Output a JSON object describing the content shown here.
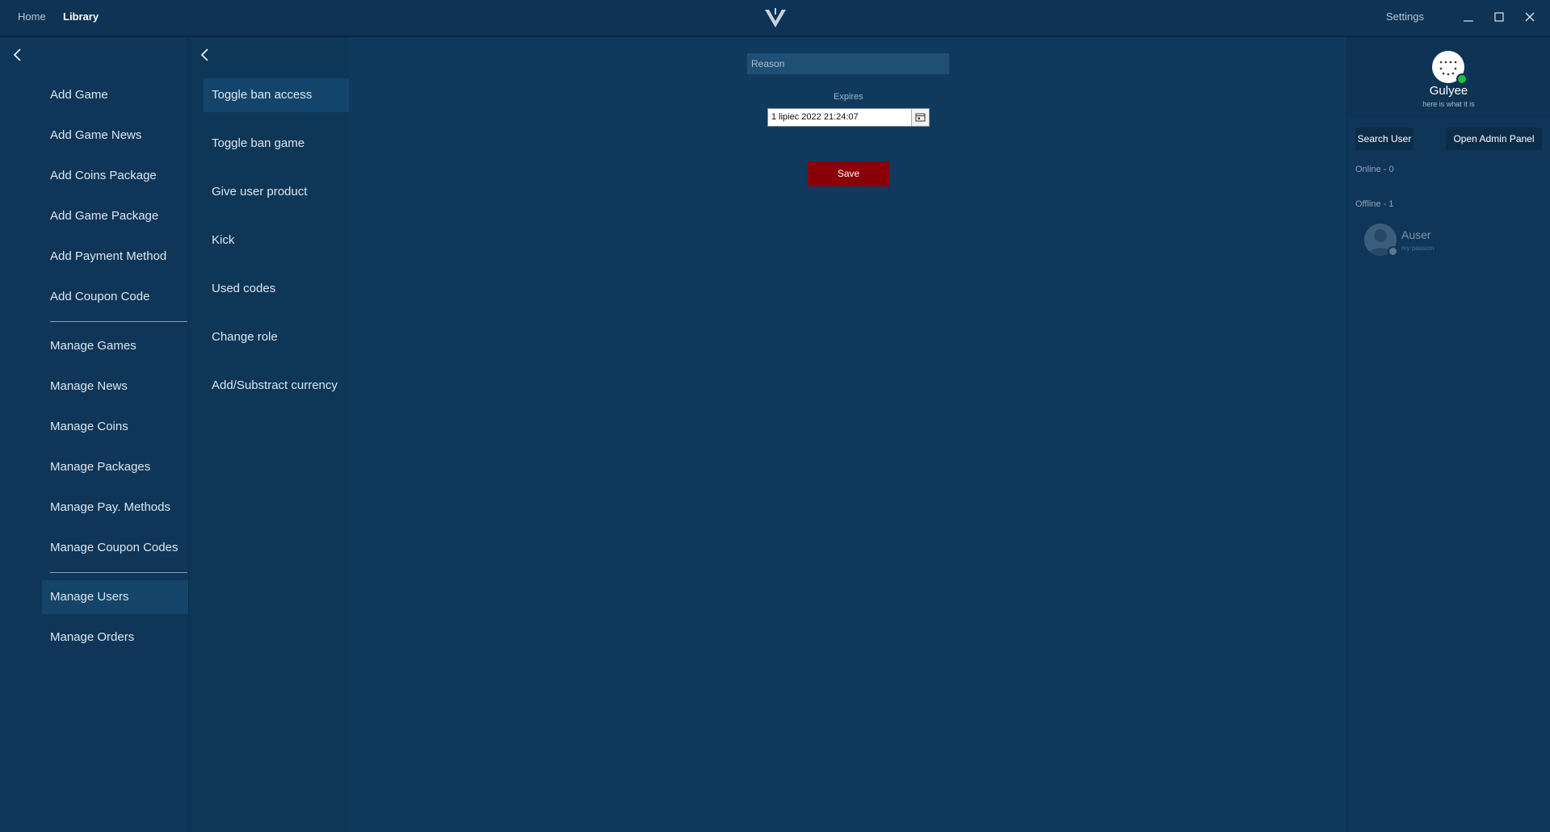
{
  "titlebar": {
    "nav": {
      "home": "Home",
      "library": "Library"
    },
    "settings": "Settings",
    "window_controls": {
      "minimize": "minimize-icon",
      "maximize": "maximize-icon",
      "close": "close-icon"
    }
  },
  "sidebar": {
    "groups": [
      [
        "Add Game",
        "Add Game News",
        "Add Coins Package",
        "Add Game Package",
        "Add Payment Method",
        "Add Coupon Code"
      ],
      [
        "Manage Games",
        "Manage News",
        "Manage Coins",
        "Manage Packages",
        "Manage Pay. Methods",
        "Manage Coupon Codes"
      ],
      [
        "Manage Users",
        "Manage Orders"
      ]
    ],
    "active": "Manage Users"
  },
  "submenu": {
    "items": [
      "Toggle ban access",
      "Toggle ban game",
      "Give user product",
      "Kick",
      "Used codes",
      "Change role",
      "Add/Substract currency"
    ],
    "active": "Toggle ban access"
  },
  "form": {
    "reason_placeholder": "Reason",
    "reason_value": "",
    "expires_label": "Expires",
    "expires_value": "1 lipiec 2022 21:24:07",
    "save_label": "Save"
  },
  "profile": {
    "name": "Gulyee",
    "status": "here is what it is",
    "online": true
  },
  "right_panel": {
    "search_user_label": "Search User",
    "open_admin_label": "Open Admin Panel",
    "online_label": "Online - 0",
    "offline_label": "Offline - 1",
    "friends": [
      {
        "name": "Auser",
        "status": "my passion"
      }
    ]
  },
  "colors": {
    "background": "#0f3a5e",
    "save_button": "#8a0008",
    "online_dot": "#1fbf3a",
    "active_item": "#144469"
  }
}
